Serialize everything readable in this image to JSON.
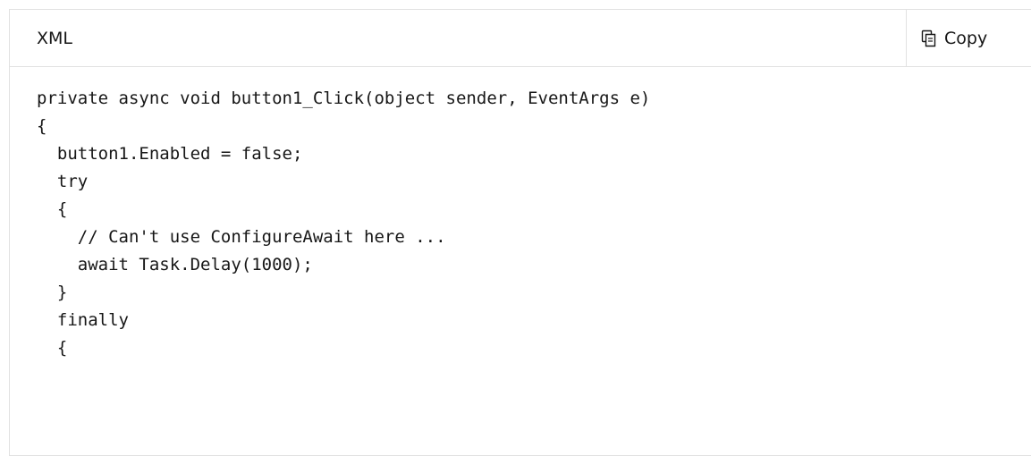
{
  "code_block": {
    "language": "XML",
    "copy_label": "Copy",
    "copy_icon": "copy-icon",
    "lines": [
      "private async void button1_Click(object sender, EventArgs e)",
      "{",
      "  button1.Enabled = false;",
      "  try",
      "  {",
      "    // Can't use ConfigureAwait here ...",
      "    await Task.Delay(1000);",
      "  }",
      "  finally",
      "  {"
    ]
  }
}
